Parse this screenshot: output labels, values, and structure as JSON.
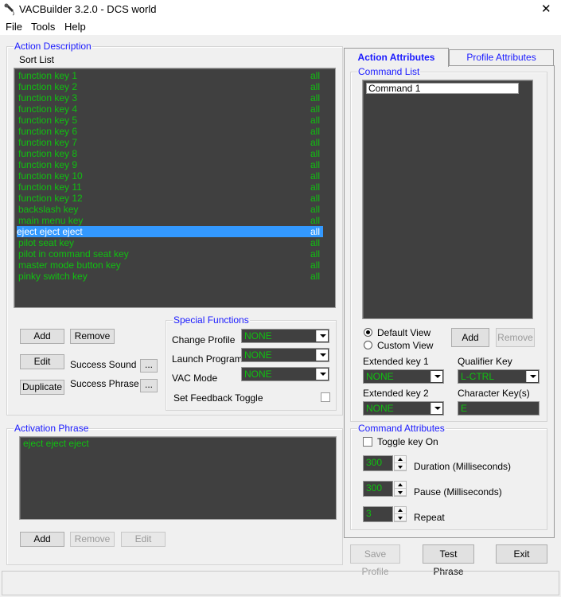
{
  "window": {
    "title": "VACBuilder 3.2.0 - DCS world",
    "close": "✕"
  },
  "menu": [
    "File",
    "Tools",
    "Help"
  ],
  "action_description": {
    "title": "Action Description",
    "sort_label": "Sort List",
    "items": [
      {
        "name": "function key 1",
        "scope": "all"
      },
      {
        "name": "function key 2",
        "scope": "all"
      },
      {
        "name": "function key 3",
        "scope": "all"
      },
      {
        "name": "function key 4",
        "scope": "all"
      },
      {
        "name": "function key 5",
        "scope": "all"
      },
      {
        "name": "function key 6",
        "scope": "all"
      },
      {
        "name": "function key 7",
        "scope": "all"
      },
      {
        "name": "function key 8",
        "scope": "all"
      },
      {
        "name": "function key 9",
        "scope": "all"
      },
      {
        "name": "function key 10",
        "scope": "all"
      },
      {
        "name": "function key 11",
        "scope": "all"
      },
      {
        "name": "function key 12",
        "scope": "all"
      },
      {
        "name": "backslash key",
        "scope": "all"
      },
      {
        "name": "main menu key",
        "scope": "all"
      },
      {
        "name": "eject eject eject",
        "scope": "all",
        "selected": true
      },
      {
        "name": "pilot seat key",
        "scope": "all"
      },
      {
        "name": "pilot in command seat key",
        "scope": "all"
      },
      {
        "name": "master mode button key",
        "scope": "all"
      },
      {
        "name": "pinky switch key",
        "scope": "all"
      }
    ],
    "buttons": {
      "add": "Add",
      "remove": "Remove",
      "edit": "Edit",
      "duplicate": "Duplicate",
      "ellipsis": "..."
    },
    "success_sound": "Success Sound",
    "success_phrase": "Success Phrase"
  },
  "special_functions": {
    "title": "Special Functions",
    "change_profile": "Change Profile",
    "change_profile_value": "NONE",
    "launch_program": "Launch Program",
    "launch_program_value": "NONE",
    "vac_mode": "VAC Mode",
    "vac_mode_value": "NONE",
    "feedback_toggle": "Set Feedback Toggle"
  },
  "activation_phrase": {
    "title": "Activation Phrase",
    "text": "eject eject eject",
    "add": "Add",
    "remove": "Remove",
    "edit": "Edit"
  },
  "tabs": {
    "action": "Action Attributes",
    "profile": "Profile Attributes"
  },
  "command_list": {
    "title": "Command List",
    "items": [
      "Command 1"
    ],
    "default_view": "Default View",
    "custom_view": "Custom View",
    "add": "Add",
    "remove": "Remove",
    "ext1_label": "Extended key 1",
    "ext1_value": "NONE",
    "qualifier_label": "Qualifier Key",
    "qualifier_value": "L-CTRL",
    "ext2_label": "Extended key 2",
    "ext2_value": "NONE",
    "char_label": "Character Key(s)",
    "char_value": "E"
  },
  "command_attributes": {
    "title": "Command Attributes",
    "toggle": "Toggle key On",
    "duration": "300",
    "duration_label": "Duration (Milliseconds)",
    "pause": "300",
    "pause_label": "Pause (Milliseconds)",
    "repeat": "3",
    "repeat_label": "Repeat"
  },
  "footer": {
    "save": "Save Profile",
    "test": "Test Phrase",
    "exit": "Exit"
  },
  "colors": {
    "list_bg": "#404040",
    "list_text": "#10c010",
    "selection": "#3399ff",
    "group_title": "#1a1aff"
  }
}
